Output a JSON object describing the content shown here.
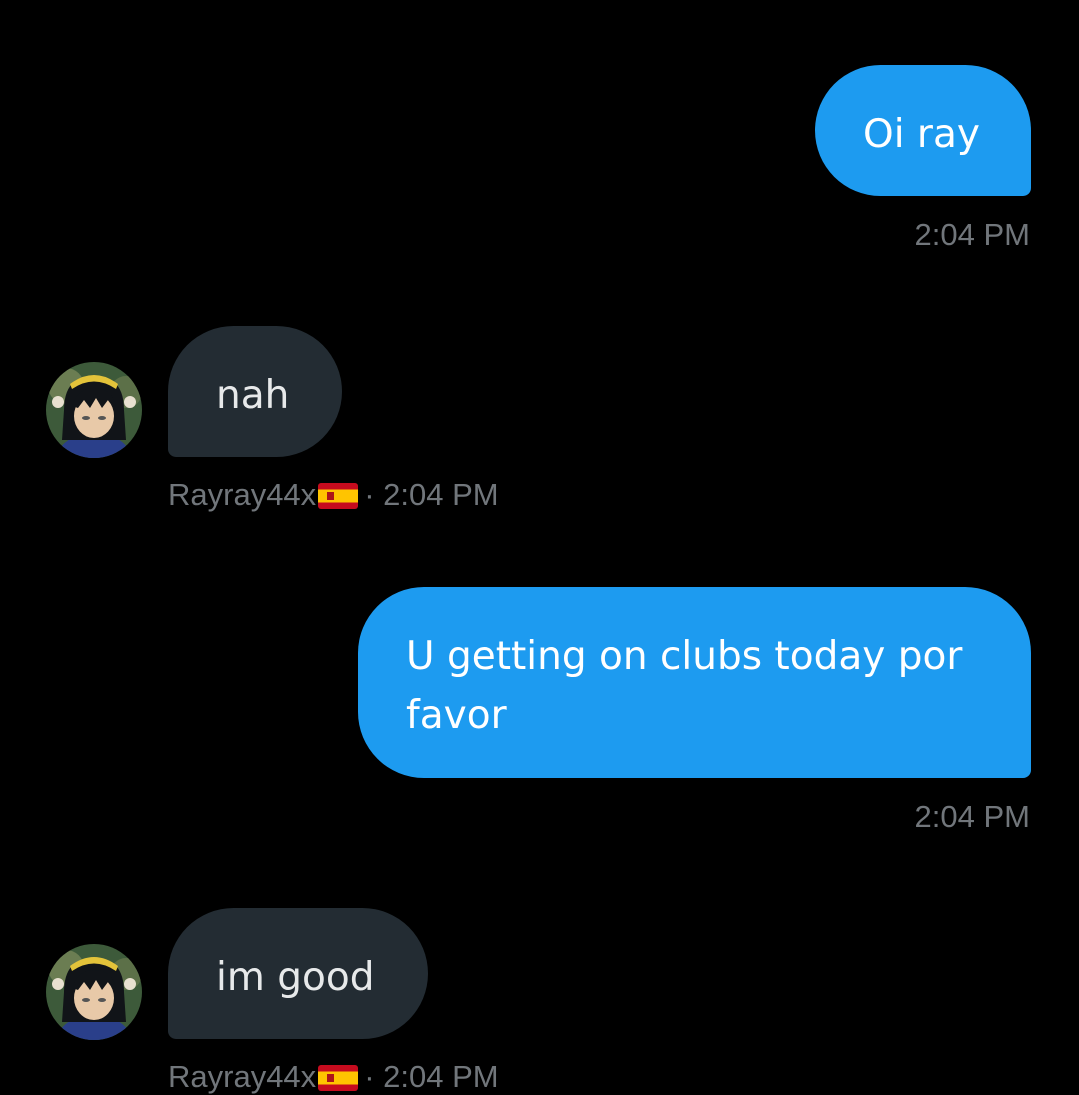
{
  "colors": {
    "background": "#000000",
    "sent_bubble": "#1d9bf0",
    "received_bubble": "#232c33",
    "meta_text": "#71767b"
  },
  "messages": [
    {
      "direction": "sent",
      "text": "Oi ray",
      "time": "2:04 PM"
    },
    {
      "direction": "received",
      "text": "nah",
      "sender": "Rayray44x",
      "sender_flag": "spain-flag-icon",
      "separator": "·",
      "time": "2:04 PM"
    },
    {
      "direction": "sent",
      "text": "U getting on clubs today por favor",
      "time": "2:04 PM"
    },
    {
      "direction": "received",
      "text": "im good",
      "sender": "Rayray44x",
      "sender_flag": "spain-flag-icon",
      "separator": "·",
      "time": "2:04 PM"
    }
  ]
}
